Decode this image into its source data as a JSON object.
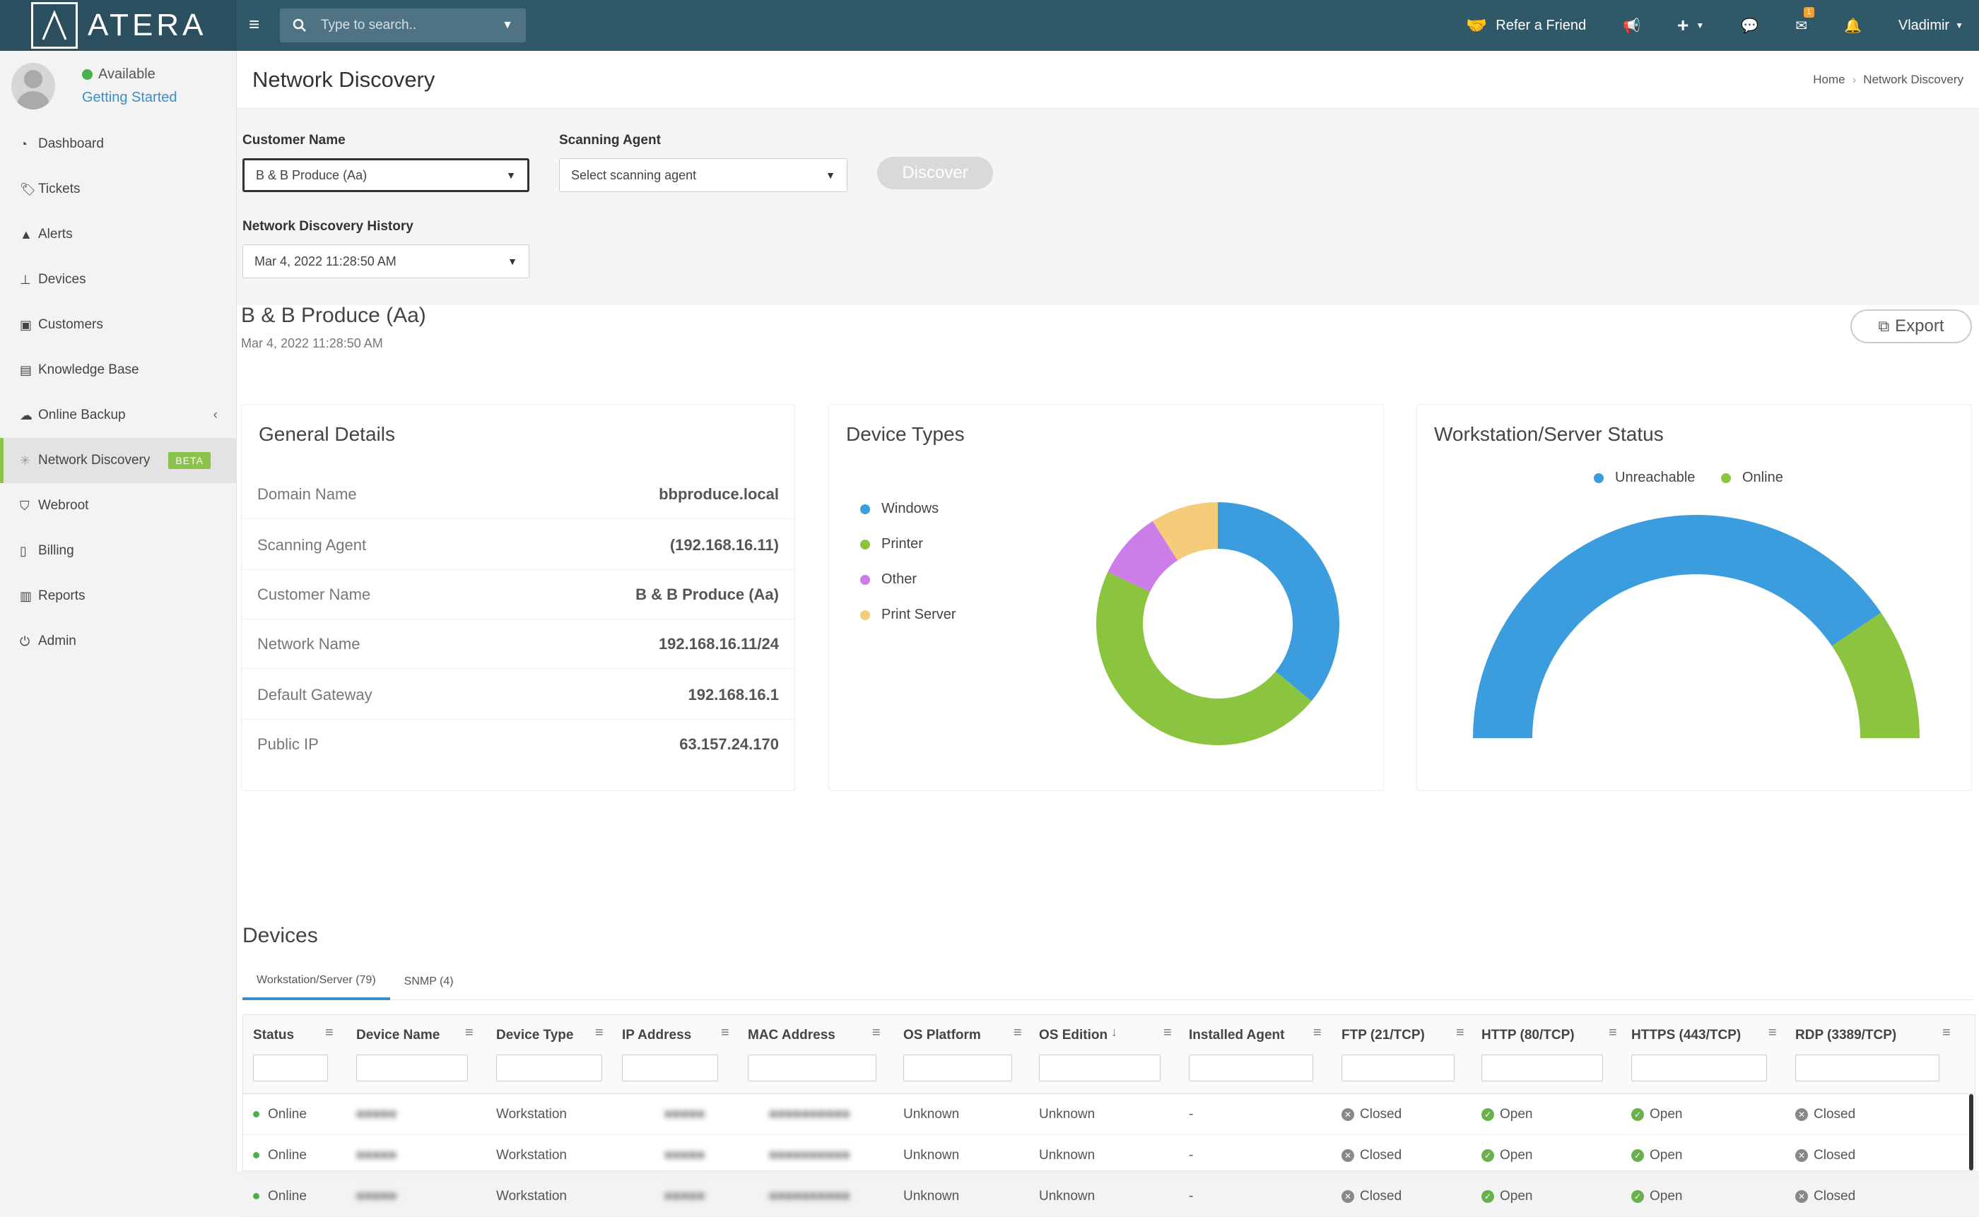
{
  "topbar": {
    "logo": "ATERA",
    "search_placeholder": "Type to search..",
    "refer": "Refer a Friend",
    "mail_badge": "1",
    "user": "Vladimir"
  },
  "profile": {
    "status": "Available",
    "link": "Getting Started"
  },
  "nav": [
    {
      "label": "Dashboard",
      "icon": "dashboard-icon"
    },
    {
      "label": "Tickets",
      "icon": "tags-icon"
    },
    {
      "label": "Alerts",
      "icon": "warning-icon"
    },
    {
      "label": "Devices",
      "icon": "sitemap-icon"
    },
    {
      "label": "Customers",
      "icon": "briefcase-icon"
    },
    {
      "label": "Knowledge Base",
      "icon": "book-icon"
    },
    {
      "label": "Online Backup",
      "icon": "cloud-icon"
    },
    {
      "label": "Network Discovery",
      "icon": "network-icon",
      "badge": "BETA"
    },
    {
      "label": "Webroot",
      "icon": "shield-icon"
    },
    {
      "label": "Billing",
      "icon": "file-icon"
    },
    {
      "label": "Reports",
      "icon": "bar-chart-icon"
    },
    {
      "label": "Admin",
      "icon": "power-icon"
    }
  ],
  "header": {
    "title": "Network Discovery",
    "crumb_home": "Home",
    "crumb_current": "Network Discovery"
  },
  "filters": {
    "customer_label": "Customer Name",
    "customer_value": "B & B Produce (Aa)",
    "agent_label": "Scanning Agent",
    "agent_placeholder": "Select scanning agent",
    "discover": "Discover",
    "history_label": "Network Discovery History",
    "history_value": "Mar 4, 2022 11:28:50 AM"
  },
  "report": {
    "customer": "B & B Produce (Aa)",
    "date": "Mar 4, 2022 11:28:50 AM",
    "export": "Export"
  },
  "general": {
    "title": "General Details",
    "rows": [
      {
        "k": "Domain Name",
        "v": "bbproduce.local"
      },
      {
        "k": "Scanning Agent",
        "v": "(192.168.16.11)"
      },
      {
        "k": "Customer Name",
        "v": "B & B Produce (Aa)"
      },
      {
        "k": "Network Name",
        "v": "192.168.16.11/24"
      },
      {
        "k": "Default Gateway",
        "v": "192.168.16.1"
      },
      {
        "k": "Public IP",
        "v": "63.157.24.170"
      }
    ]
  },
  "device_types": {
    "title": "Device Types",
    "legend": [
      "Windows",
      "Printer",
      "Other",
      "Print Server"
    ]
  },
  "ws_status": {
    "title": "Workstation/Server Status",
    "legend": [
      "Unreachable",
      "Online"
    ]
  },
  "chart_data": [
    {
      "type": "pie",
      "title": "Device Types",
      "labels": [
        "Windows",
        "Printer",
        "Other",
        "Print Server"
      ],
      "values": [
        36,
        46,
        9,
        9
      ],
      "colors": [
        "#3b9ddd",
        "#8bc540",
        "#cc7de8",
        "#f5cd7a"
      ],
      "donut": true
    },
    {
      "type": "pie",
      "title": "Workstation/Server Status",
      "labels": [
        "Unreachable",
        "Online"
      ],
      "values": [
        81,
        19
      ],
      "colors": [
        "#3b9ddd",
        "#8bc540"
      ],
      "half_donut": true
    }
  ],
  "devices": {
    "title": "Devices",
    "tabs": [
      "Workstation/Server (79)",
      "SNMP (4)"
    ],
    "columns": [
      "Status",
      "Device Name",
      "Device Type",
      "IP Address",
      "MAC Address",
      "OS Platform",
      "OS Edition",
      "Installed Agent",
      "FTP (21/TCP)",
      "HTTP (80/TCP)",
      "HTTPS (443/TCP)",
      "RDP (3389/TCP)"
    ],
    "rows": [
      [
        "Online",
        "■■■■■",
        "Workstation",
        "■■■■■",
        "■■■■■■■■■■",
        "Unknown",
        "Unknown",
        "-",
        "Closed",
        "Open",
        "Open",
        "Closed"
      ],
      [
        "Online",
        "■■■■■",
        "Workstation",
        "■■■■■",
        "■■■■■■■■■■",
        "Unknown",
        "Unknown",
        "-",
        "Closed",
        "Open",
        "Open",
        "Closed"
      ],
      [
        "Online",
        "■■■■■",
        "Workstation",
        "■■■■■",
        "■■■■■■■■■■",
        "Unknown",
        "Unknown",
        "-",
        "Closed",
        "Open",
        "Open",
        "Closed"
      ]
    ]
  }
}
